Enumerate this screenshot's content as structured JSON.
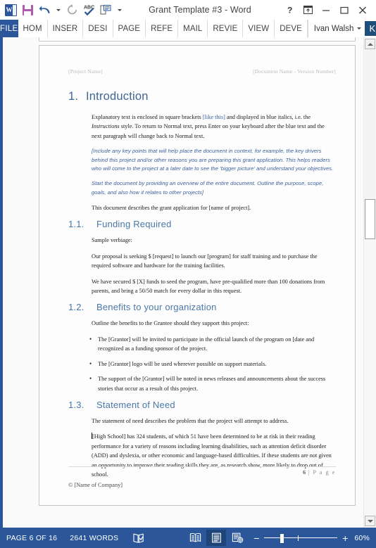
{
  "titlebar": {
    "app_icon": "word-logo-icon",
    "quick_access": [
      {
        "name": "save-button",
        "icon": "floppy-disk-icon"
      },
      {
        "name": "undo-button",
        "icon": "undo-arrow-icon"
      },
      {
        "name": "undo-dropdown",
        "icon": "chevron-down-icon"
      },
      {
        "name": "redo-button",
        "icon": "redo-arrow-icon"
      },
      {
        "name": "spelling-grammar-button",
        "icon": "abc-check-icon",
        "label": "ABC"
      },
      {
        "name": "print-preview-button",
        "icon": "print-preview-icon"
      },
      {
        "name": "customize-qat-button",
        "icon": "chevron-down-icon"
      }
    ],
    "title": "Grant Template #3 - Word",
    "window_controls": [
      {
        "name": "help-button",
        "icon": "question-mark-icon",
        "label": "?"
      },
      {
        "name": "ribbon-display-options-button",
        "icon": "ribbon-options-icon"
      },
      {
        "name": "minimize-button",
        "icon": "minimize-icon"
      },
      {
        "name": "restore-button",
        "icon": "restore-window-icon"
      },
      {
        "name": "close-button",
        "icon": "close-x-icon"
      }
    ]
  },
  "ribbon": {
    "file_tab": "FILE",
    "tabs": [
      "HOM",
      "INSER",
      "DESI",
      "PAGE",
      "REFE",
      "MAIL",
      "REVIE",
      "VIEW",
      "DEVE"
    ],
    "user_name": "Ivan Walsh",
    "avatar_initial": "K"
  },
  "document": {
    "header": {
      "left": "[Project Name]",
      "right": "[Document Name - Version Number]"
    },
    "h1": {
      "num": "1.",
      "text": "Introduction"
    },
    "intro_paragraphs": [
      {
        "style": "normal",
        "runs": [
          {
            "text": "Explanatory text is enclosed in square brackets "
          },
          {
            "text": "[like this]",
            "color": "blue"
          },
          {
            "text": " and displayed in blue italics, i.e. the "
          },
          {
            "text": "Instructions",
            "italic": true
          },
          {
            "text": " style. To return to Normal text, press Enter on your keyboard after the blue text and the next paragraph will change back to Normal text."
          }
        ]
      },
      {
        "style": "instructions",
        "text": "[Include any key points that will help place the document in context, for example, the key drivers behind this project and/or other reasons you are preparing this grant application. This helps readers who will come to the project at a later date to see the 'bigger picture' and understand your objectives."
      },
      {
        "style": "instructions",
        "text": "Start the document by providing an overview of the entire document. Outline the purpose, scope, goals, and also how it relates to other projects]"
      },
      {
        "style": "normal",
        "text": "This document describes the grant application for [name of project]."
      }
    ],
    "sections": [
      {
        "num": "1.1.",
        "title": "Funding Required",
        "paragraphs": [
          "Sample verbiage:",
          "Our proposal is seeking $ [request] to launch our [program] for staff training and to purchase the required software and hardware for the training facilities.",
          "We have secured $ [X] funds to seed the program, have pre-qualified more than 100 donations from parents, and bring a 50/50 match for every dollar in this request."
        ],
        "bullets": []
      },
      {
        "num": "1.2.",
        "title": "Benefits to your organization",
        "paragraphs": [
          "Outline the benefits to the Grantee should they support this project:"
        ],
        "bullets": [
          "The [Grantor] will be invited to participate in the official launch of the program on [date and recognized as a funding sponsor of the project.",
          "The [Grantor] logo will be used wherever possible on support materials.",
          "The support of the [Grantor] will be noted in news releases and announcements about the success stories that occur as a result of this project."
        ]
      },
      {
        "num": "1.3.",
        "title": "Statement of Need",
        "paragraphs": [
          "The statement of need describes the problem that the project will attempt to address.",
          "[High School] has 324 students, of which 51 have been determined to be at risk in their reading performance for a variety of reasons including learning disabilities, such as attention deficit disorder (ADD) and dyslexia, or other economic and language-based difficulties. If these students are not given an opportunity to improve their reading skills they are, as research show, more likely to drop out of school."
        ],
        "bullets": []
      }
    ],
    "footer": {
      "page_number": "6",
      "page_label": "P a g e",
      "separator": "|",
      "copyright": "© [Name of Company]"
    }
  },
  "statusbar": {
    "page_status": "PAGE 6 OF 16",
    "word_count": "2641 WORDS",
    "proofing_icon": "proofing-errors-icon",
    "views": [
      {
        "name": "read-mode-button",
        "icon": "read-mode-icon",
        "active": false
      },
      {
        "name": "print-layout-button",
        "icon": "print-layout-icon",
        "active": true
      },
      {
        "name": "web-layout-button",
        "icon": "web-layout-icon",
        "active": false
      }
    ],
    "zoom_out": "−",
    "zoom_in": "+",
    "zoom_level": "60%"
  },
  "colors": {
    "word_blue": "#2b579a",
    "heading_blue": "#3f6593",
    "subheading_blue": "#4a77a8",
    "instruction_blue": "#3a5f9e",
    "save_purple": "#b05bb0",
    "avatar_navy": "#1f4e79"
  }
}
